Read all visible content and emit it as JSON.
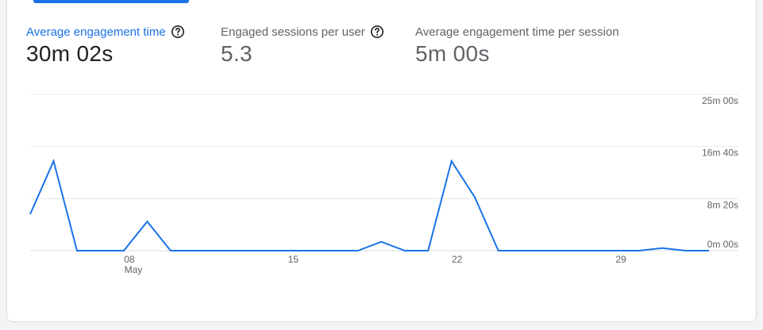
{
  "metrics": [
    {
      "label": "Average engagement time",
      "value": "30m 02s",
      "active": true
    },
    {
      "label": "Engaged sessions per user",
      "value": "5.3",
      "active": false
    },
    {
      "label": "Average engagement time per session",
      "value": "5m 00s",
      "active": false
    }
  ],
  "icons": {
    "help": "help-circle-icon"
  },
  "colors": {
    "accent": "#1a73e8",
    "line": "#1a73e8",
    "grid": "#e8eaed",
    "text_secondary": "#5f6368",
    "text_primary": "#202124"
  },
  "chart_data": {
    "type": "line",
    "x": [
      "May 4",
      "May 5",
      "May 6",
      "May 7",
      "May 8",
      "May 9",
      "May 10",
      "May 11",
      "May 12",
      "May 13",
      "May 14",
      "May 15",
      "May 16",
      "May 17",
      "May 18",
      "May 19",
      "May 20",
      "May 21",
      "May 22",
      "May 23",
      "May 24",
      "May 25",
      "May 26",
      "May 27",
      "May 28",
      "May 29",
      "May 30",
      "May 31",
      "Jun 1",
      "Jun 2"
    ],
    "series": [
      {
        "values": [
          350,
          860,
          0,
          0,
          0,
          280,
          0,
          0,
          0,
          0,
          0,
          0,
          0,
          0,
          0,
          85,
          0,
          0,
          860,
          510,
          0,
          0,
          0,
          0,
          0,
          0,
          0,
          25,
          0,
          0
        ]
      }
    ],
    "x_ticks": [
      {
        "label": "08",
        "sublabel": "May",
        "index": 4
      },
      {
        "label": "15",
        "sublabel": "",
        "index": 11
      },
      {
        "label": "22",
        "sublabel": "",
        "index": 18
      },
      {
        "label": "29",
        "sublabel": "",
        "index": 25
      }
    ],
    "y_ticks": [
      {
        "label": "0m 00s",
        "value": 0
      },
      {
        "label": "8m 20s",
        "value": 500
      },
      {
        "label": "16m 40s",
        "value": 1000
      },
      {
        "label": "25m 00s",
        "value": 1500
      }
    ],
    "ylim": [
      0,
      1500
    ],
    "ylabel": "",
    "xlabel": "",
    "title": "",
    "grid": true,
    "y_axis_position": "right"
  }
}
